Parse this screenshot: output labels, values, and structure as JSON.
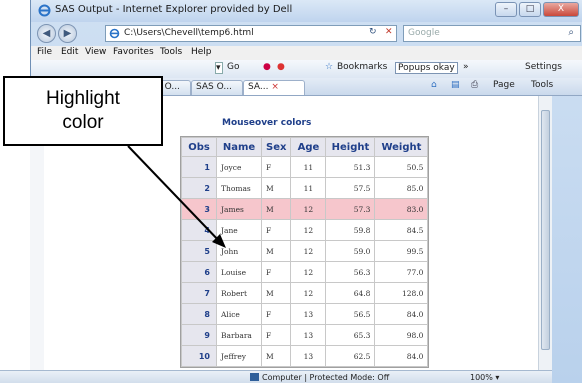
{
  "window": {
    "title": "SAS Output - Internet Explorer provided by Dell",
    "buttons": {
      "minimize": "–",
      "maximize": "□",
      "close": "X"
    }
  },
  "navigation": {
    "back_icon": "back-arrow-icon",
    "forward_icon": "forward-arrow-icon",
    "address": "C:\\Users\\Chevell\\temp6.html",
    "refresh_glyph": "↻",
    "stop_glyph": "✕",
    "search_placeholder": "Google"
  },
  "menubar": {
    "items": [
      "File",
      "Edit",
      "View",
      "Favorites",
      "Tools",
      "Help"
    ]
  },
  "toolbar": {
    "go_label": "Go",
    "bookmarks_label": "Bookmarks",
    "popups_label": "Popups okay",
    "more_label": "»",
    "settings_label": "Settings"
  },
  "tabs": {
    "items": [
      "SAS O...",
      "SAS O...",
      "SA..."
    ],
    "page_label": "Page",
    "tools_label": "Tools"
  },
  "report": {
    "title": "Mouseover colors",
    "columns": [
      "Obs",
      "Name",
      "Sex",
      "Age",
      "Height",
      "Weight"
    ],
    "rows": [
      [
        "1",
        "Joyce",
        "F",
        "11",
        "51.3",
        "50.5"
      ],
      [
        "2",
        "Thomas",
        "M",
        "11",
        "57.5",
        "85.0"
      ],
      [
        "3",
        "James",
        "M",
        "12",
        "57.3",
        "83.0"
      ],
      [
        "4",
        "Jane",
        "F",
        "12",
        "59.8",
        "84.5"
      ],
      [
        "5",
        "John",
        "M",
        "12",
        "59.0",
        "99.5"
      ],
      [
        "6",
        "Louise",
        "F",
        "12",
        "56.3",
        "77.0"
      ],
      [
        "7",
        "Robert",
        "M",
        "12",
        "64.8",
        "128.0"
      ],
      [
        "8",
        "Alice",
        "F",
        "13",
        "56.5",
        "84.0"
      ],
      [
        "9",
        "Barbara",
        "F",
        "13",
        "65.3",
        "98.0"
      ],
      [
        "10",
        "Jeffrey",
        "M",
        "13",
        "62.5",
        "84.0"
      ]
    ],
    "highlight_row": 2,
    "highlight_color": "#f6c6cc",
    "header_color": "#1f3f8a"
  },
  "callout": {
    "line1": "Highlight",
    "line2": "color"
  },
  "status": {
    "protected_mode": "Computer | Protected Mode: Off",
    "zoom": "100%"
  }
}
